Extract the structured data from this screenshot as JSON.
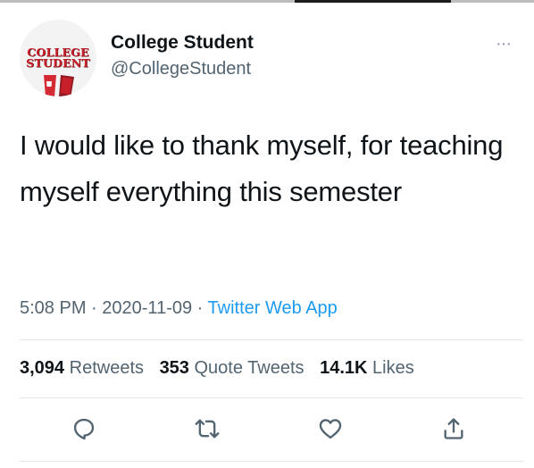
{
  "author": {
    "name": "College Student",
    "handle": "@CollegeStudent",
    "avatar_text_line1": "COLLEGE",
    "avatar_text_line2": "STUDENT"
  },
  "tweet": {
    "text": "I would like to thank myself, for teaching myself everything this semester",
    "time": "5:08 PM",
    "separator": "·",
    "date": "2020-11-09",
    "source": "Twitter Web App"
  },
  "stats": {
    "retweets_count": "3,094",
    "retweets_label": "Retweets",
    "quotes_count": "353",
    "quotes_label": "Quote Tweets",
    "likes_count": "14.1K",
    "likes_label": "Likes"
  },
  "more_label": "···",
  "icons": {
    "reply": "reply-icon",
    "retweet": "retweet-icon",
    "like": "heart-icon",
    "share": "share-icon"
  },
  "colors": {
    "text": "#0f1419",
    "secondary": "#536471",
    "link": "#1d9bf0",
    "brand_red": "#c8202a"
  }
}
